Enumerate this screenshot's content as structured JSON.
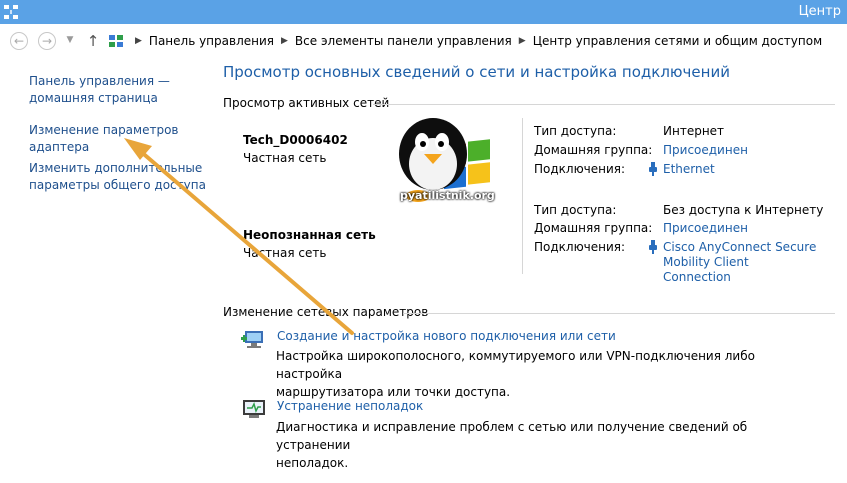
{
  "window": {
    "title": "Центр"
  },
  "breadcrumb": [
    "Панель управления",
    "Все элементы панели управления",
    "Центр управления сетями и общим доступом"
  ],
  "sidebar": {
    "items": [
      {
        "line1": "Панель управления —",
        "line2": "домашняя страница"
      },
      {
        "line1": "Изменение параметров",
        "line2": "адаптера"
      },
      {
        "line1": "Изменить дополнительные",
        "line2": "параметры общего доступа"
      }
    ]
  },
  "main": {
    "heading": "Просмотр основных сведений о сети и настройка подключений",
    "active_networks_title": "Просмотр активных сетей",
    "networks": [
      {
        "name": "Tech_D0006402",
        "type": "Частная сеть",
        "access_label": "Тип доступа:",
        "access_value": "Интернет",
        "homegroup_label": "Домашняя группа:",
        "homegroup_value": "Присоединен",
        "connections_label": "Подключения:",
        "connection_value": "Ethernet"
      },
      {
        "name": "Неопознанная сеть",
        "type": "Частная сеть",
        "access_label": "Тип доступа:",
        "access_value": "Без доступа к Интернету",
        "homegroup_label": "Домашняя группа:",
        "homegroup_value": "Присоединен",
        "connections_label": "Подключения:",
        "connection_line1": "Cisco AnyConnect Secure",
        "connection_line2": "Mobility Client",
        "connection_line3": "Connection"
      }
    ],
    "change_settings_title": "Изменение сетевых параметров",
    "tasks": [
      {
        "link": "Создание и настройка нового подключения или сети",
        "desc_line1": "Настройка широкополосного, коммутируемого или VPN-подключения либо настройка",
        "desc_line2": "маршрутизатора или точки доступа."
      },
      {
        "link": "Устранение неполадок",
        "desc_line1": "Диагностика и исправление проблем с сетью или получение сведений об устранении",
        "desc_line2": "неполадок."
      }
    ]
  },
  "watermark": {
    "text": "pyatilistnik.org"
  },
  "colors": {
    "titlebar": "#5aa2e6",
    "link": "#1e5fa8",
    "arrow": "#e8a53a"
  }
}
